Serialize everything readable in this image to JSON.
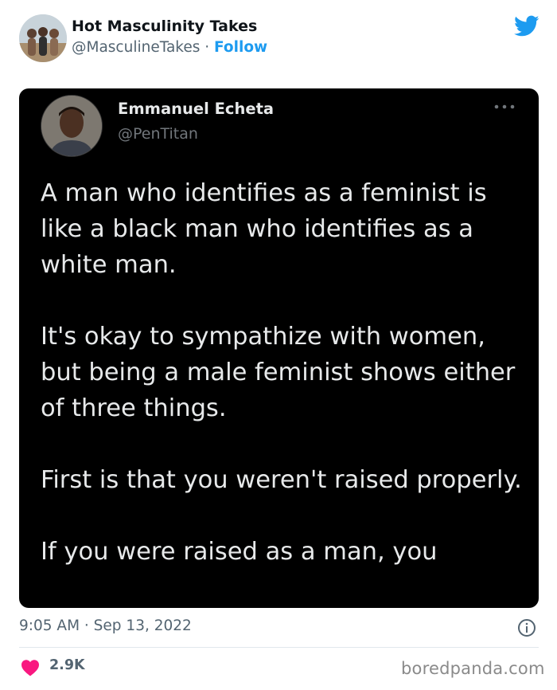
{
  "author": {
    "name": "Hot Masculinity Takes",
    "handle": "@MasculineTakes",
    "separator": "·",
    "follow_label": "Follow"
  },
  "quoted": {
    "name": "Emmanuel Echeta",
    "handle": "@PenTitan",
    "paragraphs": [
      "A man who identifies as a feminist is like a black man who identifies as a white man.",
      "It's okay to sympathize with women, but being a male feminist shows either of three things.",
      "First is that you weren't raised properly.",
      "If you were raised as a man, you"
    ]
  },
  "footer": {
    "timestamp": "9:05 AM · Sep 13, 2022",
    "likes": "2.9K"
  },
  "watermark": "boredpanda.com",
  "colors": {
    "twitter_blue": "#1d9bf0",
    "heart_red": "#f91880",
    "card_background": "#000000"
  },
  "icons": [
    "twitter-bird-icon",
    "more-options-icon",
    "info-icon",
    "heart-icon"
  ]
}
